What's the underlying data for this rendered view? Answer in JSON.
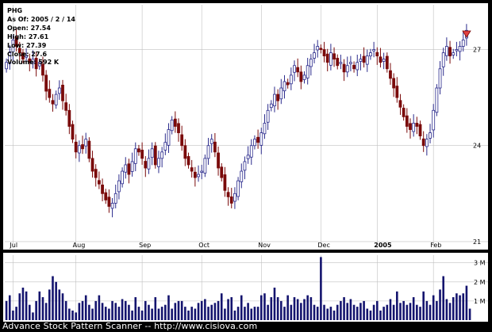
{
  "info": {
    "symbol": "PHG",
    "as_of": "As Of: 2005 / 2 / 14",
    "open": "Open: 27.54",
    "high": "High: 27.61",
    "low": "Low: 27.39",
    "close": "Close: 27.6",
    "volume": "Volume: 592 K"
  },
  "footer": "Advance Stock Pattern Scanner -- http://www.cisiova.com",
  "colors": {
    "background": "#000000",
    "panel": "#ffffff",
    "grid": "#c0c0c0",
    "up_candle": "#2a2a8c",
    "down_candle": "#7a0a0a",
    "volume_bar": "#14146e",
    "marker": "#e04040"
  },
  "chart_data": [
    {
      "type": "candlestick",
      "symbol": "PHG",
      "x_tick_labels": [
        "Jul",
        "Aug",
        "Sep",
        "Oct",
        "Nov",
        "Dec",
        "2005",
        "Feb"
      ],
      "y_tick_labels": [
        "27",
        "24",
        "21"
      ],
      "ylim": [
        20.8,
        28.4
      ],
      "grid": true,
      "marker": "down-triangle above last bar",
      "closes": [
        26.6,
        26.9,
        27.3,
        27.1,
        26.9,
        26.7,
        26.8,
        26.6,
        26.7,
        26.4,
        26.6,
        26.2,
        25.7,
        25.5,
        25.3,
        25.6,
        25.8,
        25.4,
        25.1,
        24.6,
        24.2,
        23.8,
        24.0,
        23.9,
        24.2,
        23.6,
        23.2,
        23.0,
        22.8,
        22.5,
        22.3,
        22.1,
        22.2,
        22.5,
        22.9,
        23.2,
        23.4,
        23.1,
        23.5,
        23.9,
        23.8,
        23.6,
        23.3,
        23.6,
        23.9,
        23.4,
        23.6,
        23.8,
        24.1,
        24.5,
        24.8,
        24.6,
        24.4,
        24.0,
        23.6,
        23.4,
        23.2,
        23.0,
        23.1,
        23.2,
        23.6,
        24.0,
        24.2,
        23.8,
        23.3,
        23.0,
        22.6,
        22.4,
        22.2,
        22.5,
        22.9,
        23.2,
        23.5,
        23.7,
        24.0,
        24.2,
        24.1,
        24.4,
        24.7,
        25.1,
        25.3,
        25.6,
        25.4,
        25.8,
        26.0,
        25.9,
        26.2,
        26.5,
        26.3,
        26.0,
        26.2,
        26.5,
        26.7,
        26.9,
        27.1,
        27.0,
        26.8,
        26.6,
        26.9,
        26.7,
        26.5,
        26.6,
        26.3,
        26.5,
        26.6,
        26.4,
        26.6,
        26.7,
        26.6,
        26.8,
        26.9,
        27.0,
        26.8,
        26.6,
        26.7,
        26.4,
        26.1,
        25.8,
        25.5,
        25.2,
        24.9,
        24.6,
        24.5,
        24.7,
        24.6,
        24.3,
        24.0,
        24.2,
        24.4,
        25.1,
        25.8,
        26.4,
        26.9,
        27.1,
        26.8,
        26.9,
        27.0,
        27.1,
        27.3,
        27.6
      ],
      "volume": {
        "y_tick_labels": [
          "3 M",
          "2 M",
          "1 M"
        ],
        "ylim": [
          0,
          3.4
        ],
        "values_millions": [
          1.0,
          1.3,
          0.5,
          0.7,
          1.4,
          1.7,
          1.5,
          0.8,
          0.4,
          1.0,
          1.5,
          1.2,
          0.9,
          1.6,
          2.3,
          2.0,
          1.6,
          1.4,
          1.0,
          0.6,
          0.5,
          0.4,
          0.9,
          1.0,
          1.3,
          0.8,
          0.6,
          1.0,
          1.3,
          0.9,
          0.7,
          0.6,
          1.0,
          0.9,
          0.7,
          1.1,
          1.0,
          0.8,
          0.5,
          1.2,
          0.7,
          0.5,
          1.0,
          0.8,
          0.6,
          1.2,
          0.6,
          0.7,
          0.8,
          1.3,
          0.6,
          0.9,
          1.0,
          1.0,
          0.7,
          0.5,
          0.7,
          0.6,
          0.9,
          1.0,
          1.1,
          0.7,
          0.8,
          0.9,
          1.0,
          1.4,
          0.6,
          1.1,
          1.2,
          0.5,
          0.7,
          1.3,
          0.7,
          0.9,
          0.6,
          0.7,
          0.7,
          1.3,
          1.4,
          0.8,
          1.2,
          1.7,
          1.2,
          1.0,
          0.7,
          1.3,
          0.8,
          1.2,
          1.1,
          0.9,
          1.1,
          1.3,
          1.2,
          0.8,
          0.7,
          3.3,
          0.8,
          0.6,
          0.7,
          0.5,
          0.8,
          1.0,
          1.2,
          0.9,
          1.1,
          0.8,
          0.7,
          0.9,
          1.0,
          0.6,
          0.5,
          0.8,
          1.0,
          0.5,
          0.7,
          0.8,
          1.1,
          0.8,
          1.5,
          0.9,
          1.0,
          0.8,
          0.9,
          1.2,
          0.8,
          0.7,
          1.5,
          1.0,
          0.8,
          1.3,
          1.0,
          1.6,
          2.3,
          1.1,
          0.9,
          1.2,
          1.4,
          1.3,
          1.4,
          1.8,
          0.6
        ]
      }
    }
  ]
}
